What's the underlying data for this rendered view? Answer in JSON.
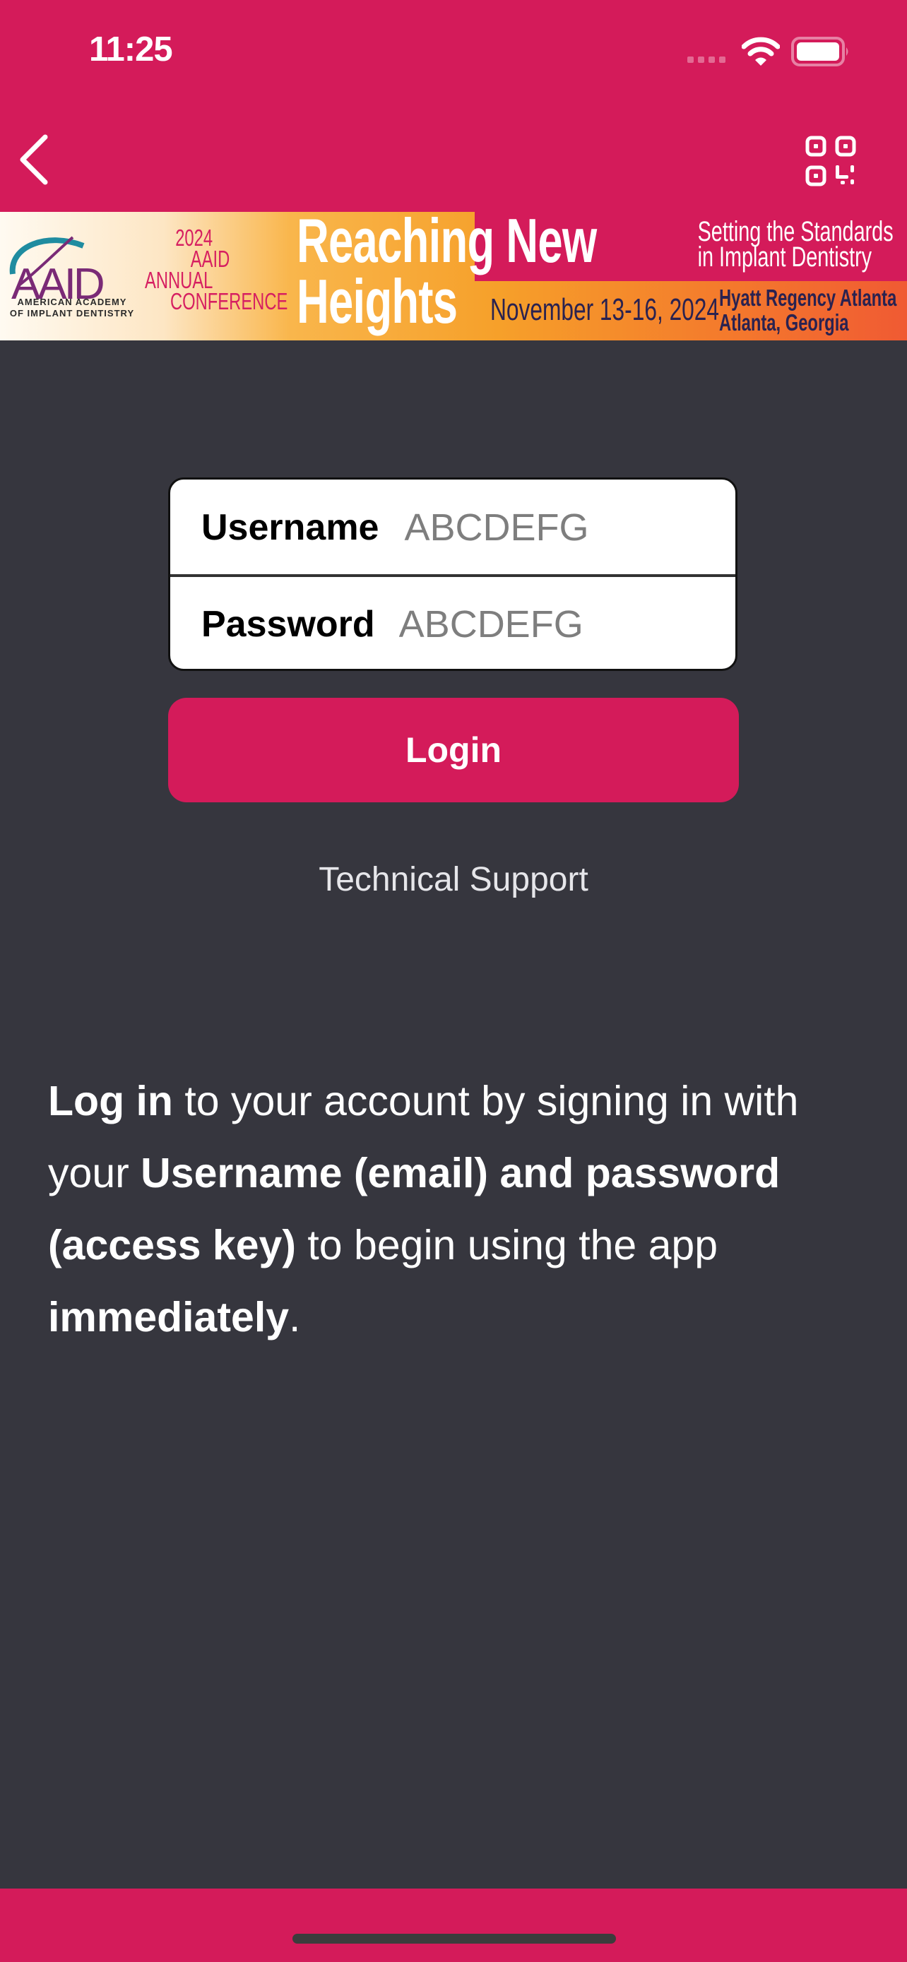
{
  "status_bar": {
    "time": "11:25",
    "icons": [
      "cellular-signal-icon",
      "wifi-icon",
      "battery-icon"
    ]
  },
  "nav": {
    "back_icon": "chevron-left-icon",
    "qr_icon": "qr-code-icon"
  },
  "banner": {
    "org_logo": "AAID",
    "org_name_line1": "AMERICAN ACADEMY",
    "org_name_line2": "OF IMPLANT DENTISTRY",
    "conference_lines": [
      "2024",
      "AAID",
      "ANNUAL",
      "CONFERENCE"
    ],
    "headline_line1": "Reaching New",
    "headline_line2": "Heights",
    "tagline_line1": "Setting the Standards",
    "tagline_line2": "in Implant Dentistry",
    "dates": "November 13-16, 2024",
    "venue_line1": "Hyatt Regency Atlanta",
    "venue_line2": "Atlanta, Georgia"
  },
  "form": {
    "username_label": "Username",
    "username_placeholder": "ABCDEFG",
    "password_label": "Password",
    "password_placeholder": "ABCDEFG"
  },
  "login_button": "Login",
  "support_link": "Technical Support",
  "info": {
    "p1_bold": "Log in",
    "p1": " to your account by signing in with your ",
    "p2_bold": "Username (email) and password (access key)",
    "p2": " to begin using the app ",
    "p3_bold": "immediately",
    "p3": "."
  },
  "colors": {
    "brand": "#d41b5a",
    "background": "#36363e",
    "banner_navy": "#2a2250"
  }
}
